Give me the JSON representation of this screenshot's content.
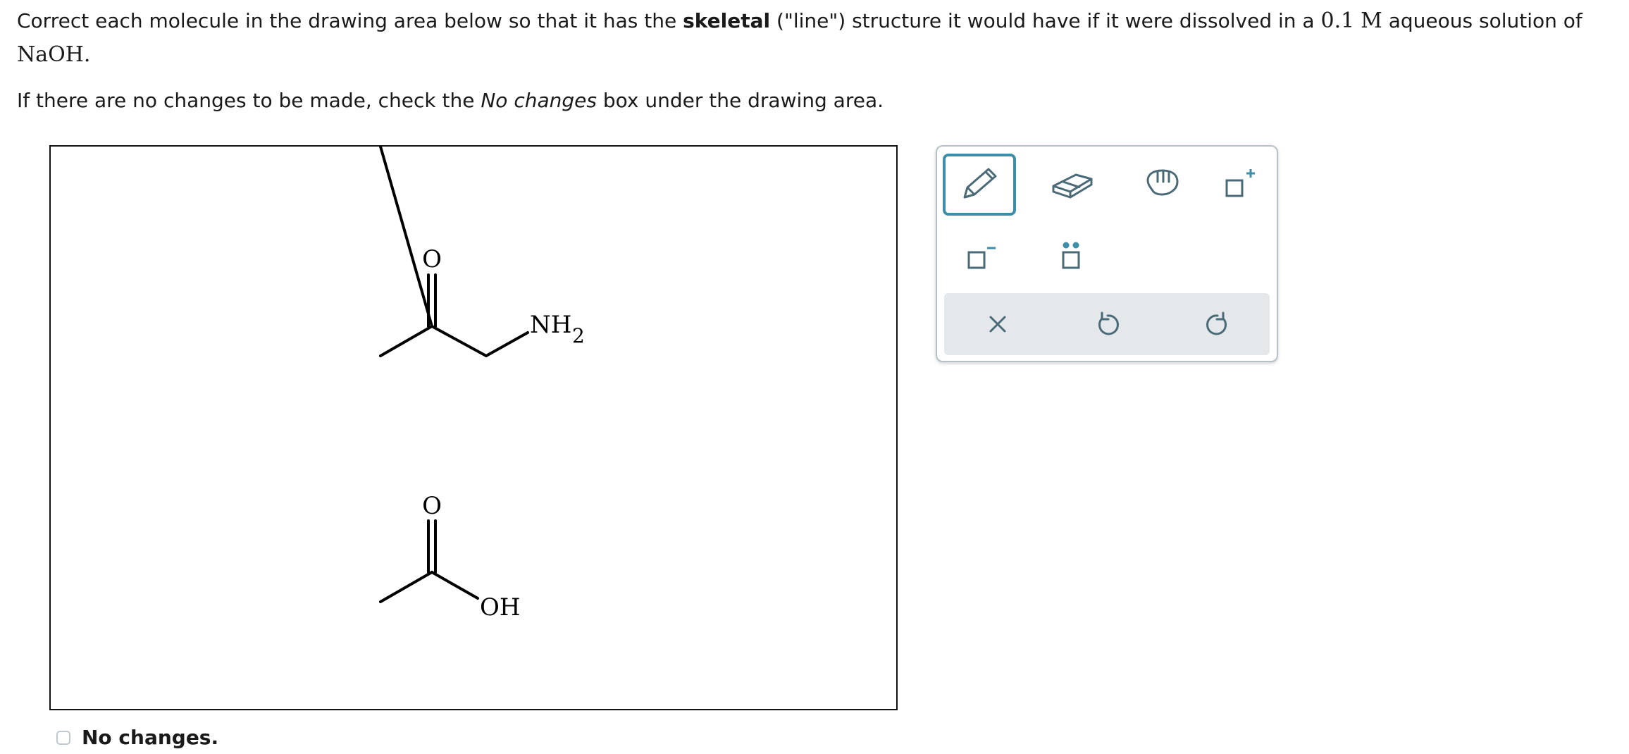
{
  "prompt": {
    "line1_pre": "Correct each molecule in the drawing area below so that it has the ",
    "line1_bold": "skeletal",
    "line1_mid": " (\"line\") structure it would have if it were dissolved in a ",
    "concentration": "0.1",
    "unit": "M",
    "line1_post": " aqueous solution of",
    "solute": "NaOH.",
    "line2_pre": "If there are no changes to be made, check the ",
    "line2_em": "No changes",
    "line2_post": " box under the drawing area."
  },
  "molecules": {
    "m1_o": "O",
    "m1_n": "NH",
    "m1_sub": "2",
    "m2_o": "O",
    "m2_oh": "OH"
  },
  "toolbar": {
    "tools": [
      "pencil-icon",
      "eraser-icon",
      "hand-icon",
      "add-charge-icon",
      "negative-charge-icon",
      "lone-pair-icon"
    ],
    "actions": [
      "clear-icon",
      "undo-icon",
      "redo-icon"
    ],
    "accent": "#3d8ea8",
    "icon_color": "#4a6a78"
  },
  "checkbox": {
    "label": "No changes.",
    "checked": false
  }
}
